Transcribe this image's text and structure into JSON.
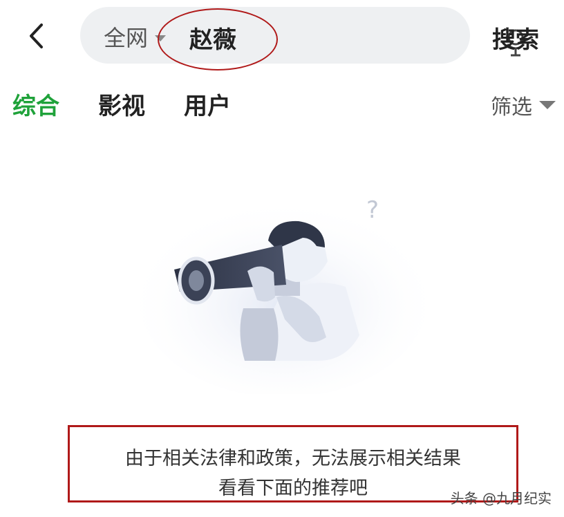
{
  "header": {
    "back_icon": "chevron-left-icon",
    "search": {
      "scope_label": "全网",
      "query": "赵薇",
      "mic_icon": "microphone-icon"
    },
    "search_button_label": "搜索"
  },
  "tabs": [
    {
      "label": "综合",
      "active": true
    },
    {
      "label": "影视",
      "active": false
    },
    {
      "label": "用户",
      "active": false
    }
  ],
  "filter_label": "筛选",
  "illustration": {
    "question_mark": "?"
  },
  "notice": {
    "line1": "由于相关法律和政策，无法展示相关结果",
    "line2": "看看下面的推荐吧"
  },
  "watermark": "头条 @九月纪实",
  "colors": {
    "accent_green": "#1fa23a",
    "annotation_red": "#b01919",
    "search_bg": "#eef0f2"
  }
}
